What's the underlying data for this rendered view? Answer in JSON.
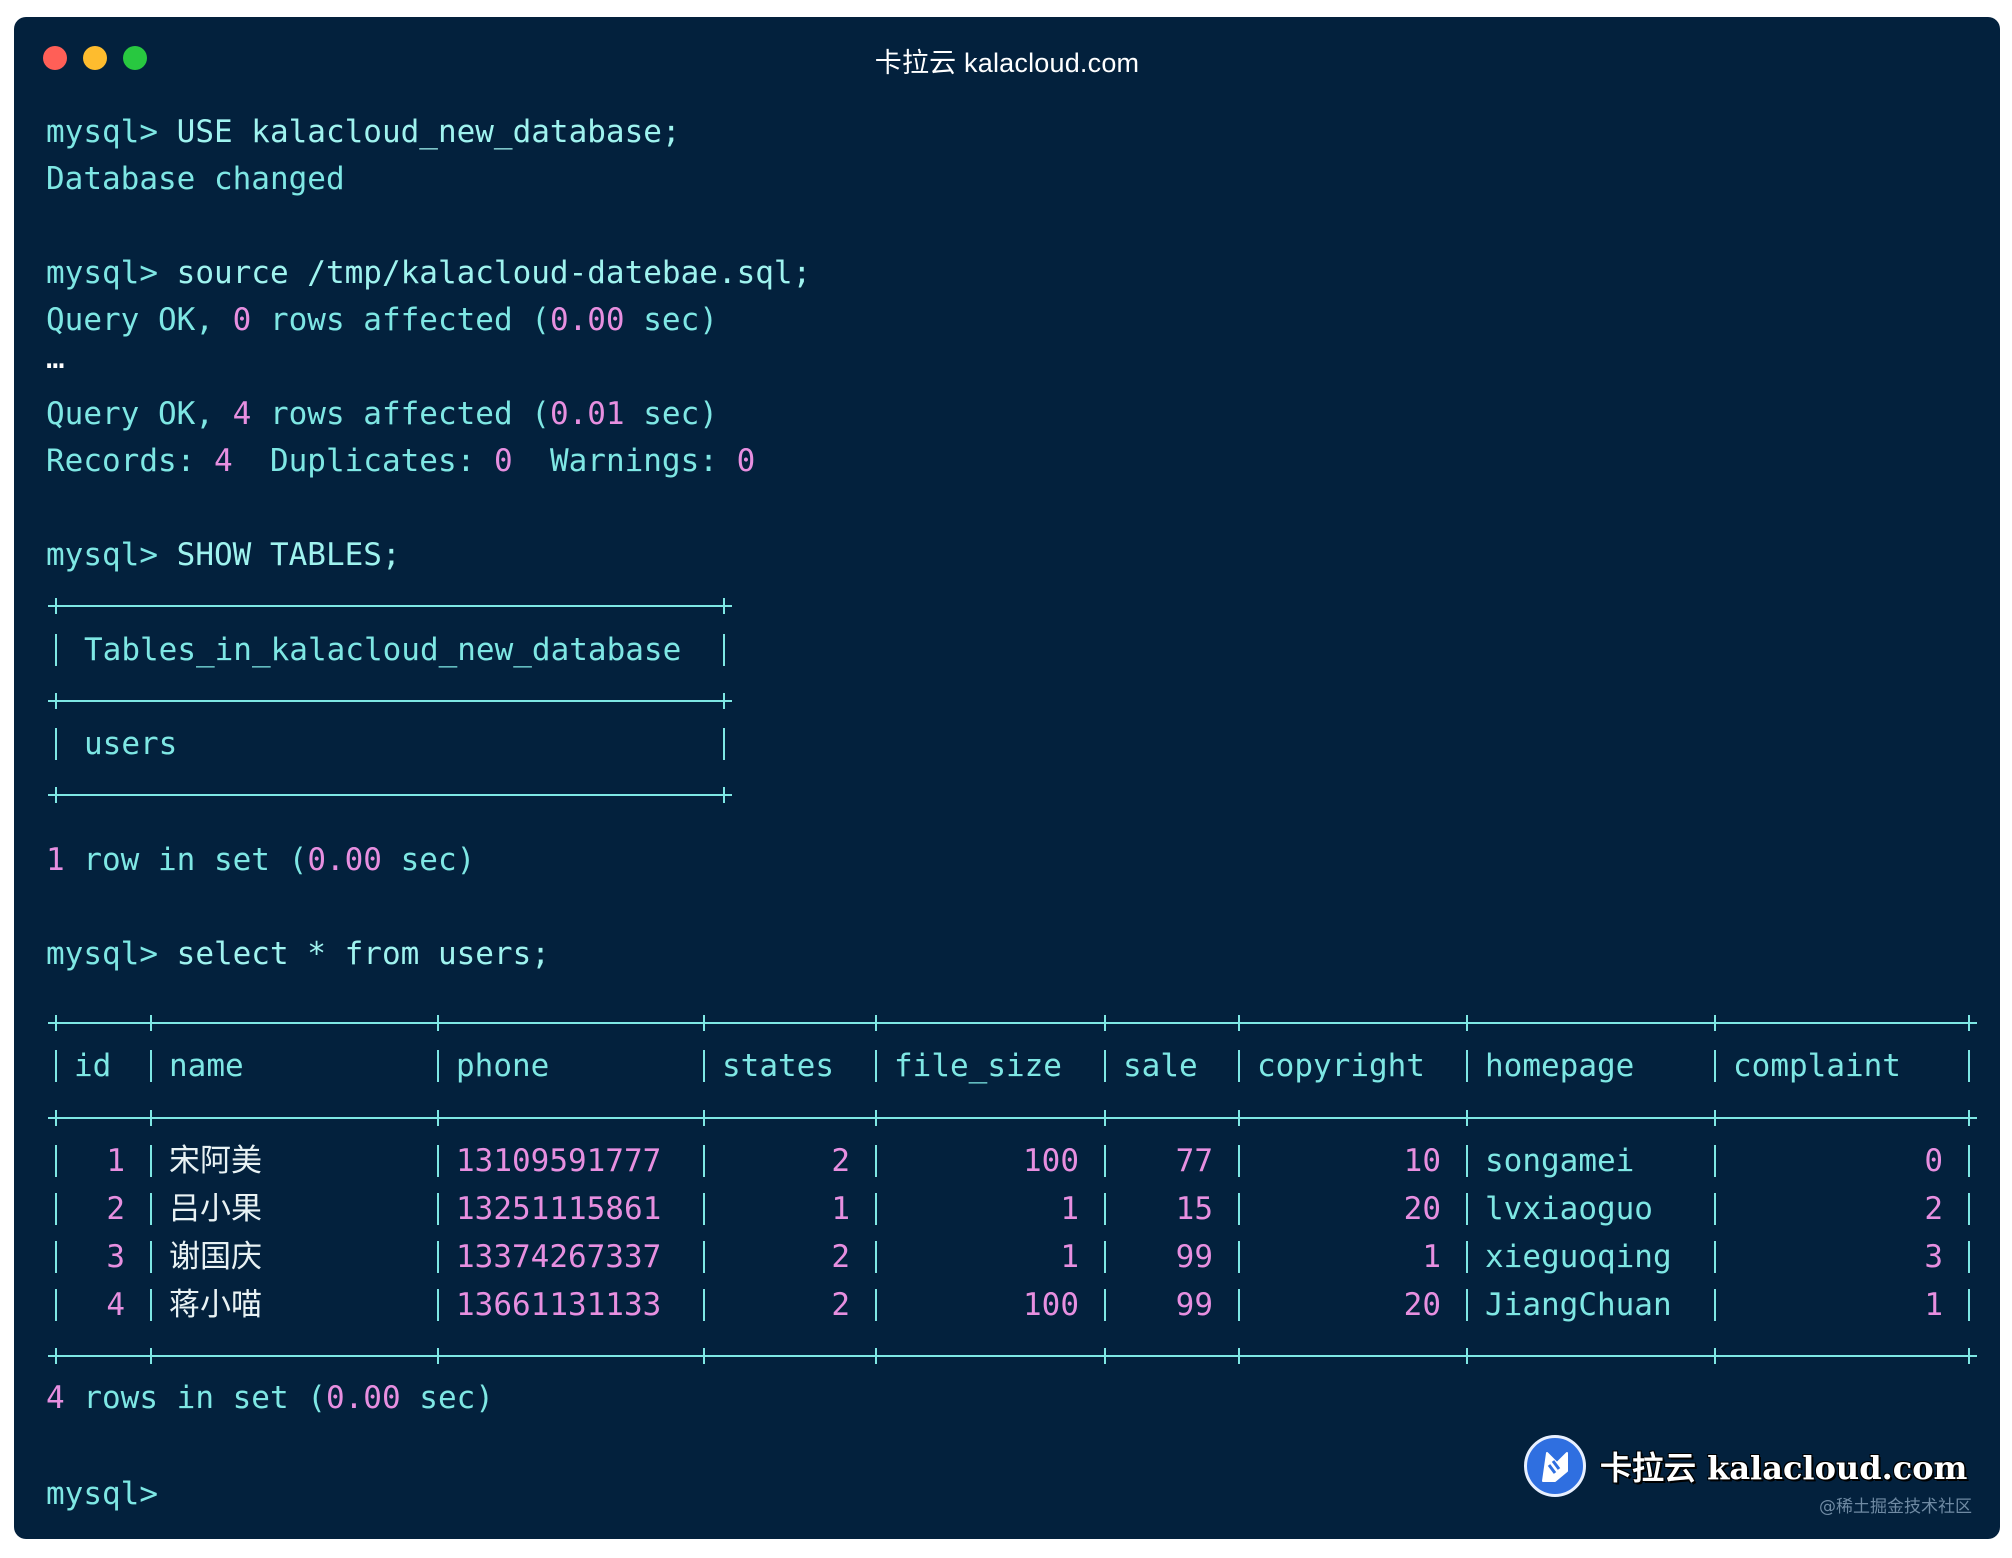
{
  "window": {
    "title": "卡拉云 kalacloud.com"
  },
  "session": {
    "cmd1_prompt": "mysql>",
    "cmd1": "USE kalacloud_new_database;",
    "out1": "Database changed",
    "cmd2_prompt": "mysql>",
    "cmd2": "source /tmp/kalacloud-datebae.sql;",
    "q1": {
      "a": "Query OK, ",
      "n": "0",
      "b": " rows affected (",
      "t": "0.00",
      "c": " sec)"
    },
    "ellipsis": "…",
    "q2": {
      "a": "Query OK, ",
      "n": "4",
      "b": " rows affected (",
      "t": "0.01",
      "c": " sec)"
    },
    "records": {
      "a": "Records: ",
      "r": "4",
      "b": "  Duplicates: ",
      "d": "0",
      "c": "  Warnings: ",
      "w": "0"
    },
    "cmd3_prompt": "mysql>",
    "cmd3": "SHOW TABLES;",
    "tables_header": "Tables_in_kalacloud_new_database",
    "tables_row": "users",
    "set1": {
      "n": "1",
      "a": " row in set (",
      "t": "0.00",
      "c": " sec)"
    },
    "cmd4_prompt": "mysql>",
    "cmd4": "select * from users;",
    "set2": {
      "n": "4",
      "a": " rows in set (",
      "t": "0.00",
      "c": " sec)"
    },
    "final_prompt": "mysql>"
  },
  "users_table": {
    "columns": [
      "id",
      "name",
      "phone",
      "states",
      "file_size",
      "sale",
      "copyright",
      "homepage",
      "complaint"
    ],
    "rows": [
      [
        "1",
        "宋阿美",
        "13109591777",
        "2",
        "100",
        "77",
        "10",
        "songamei",
        "0"
      ],
      [
        "2",
        "吕小果",
        "13251115861",
        "1",
        "1",
        "15",
        "20",
        "lvxiaoguo",
        "2"
      ],
      [
        "3",
        "谢国庆",
        "13374267337",
        "2",
        "1",
        "99",
        "1",
        "xieguoqing",
        "3"
      ],
      [
        "4",
        "蒋小喵",
        "13661131133",
        "2",
        "100",
        "99",
        "20",
        "JiangChuan",
        "1"
      ]
    ]
  },
  "branding": {
    "logo_text": "卡拉云 kalacloud.com",
    "watermark": "@稀土掘金技术社区"
  }
}
